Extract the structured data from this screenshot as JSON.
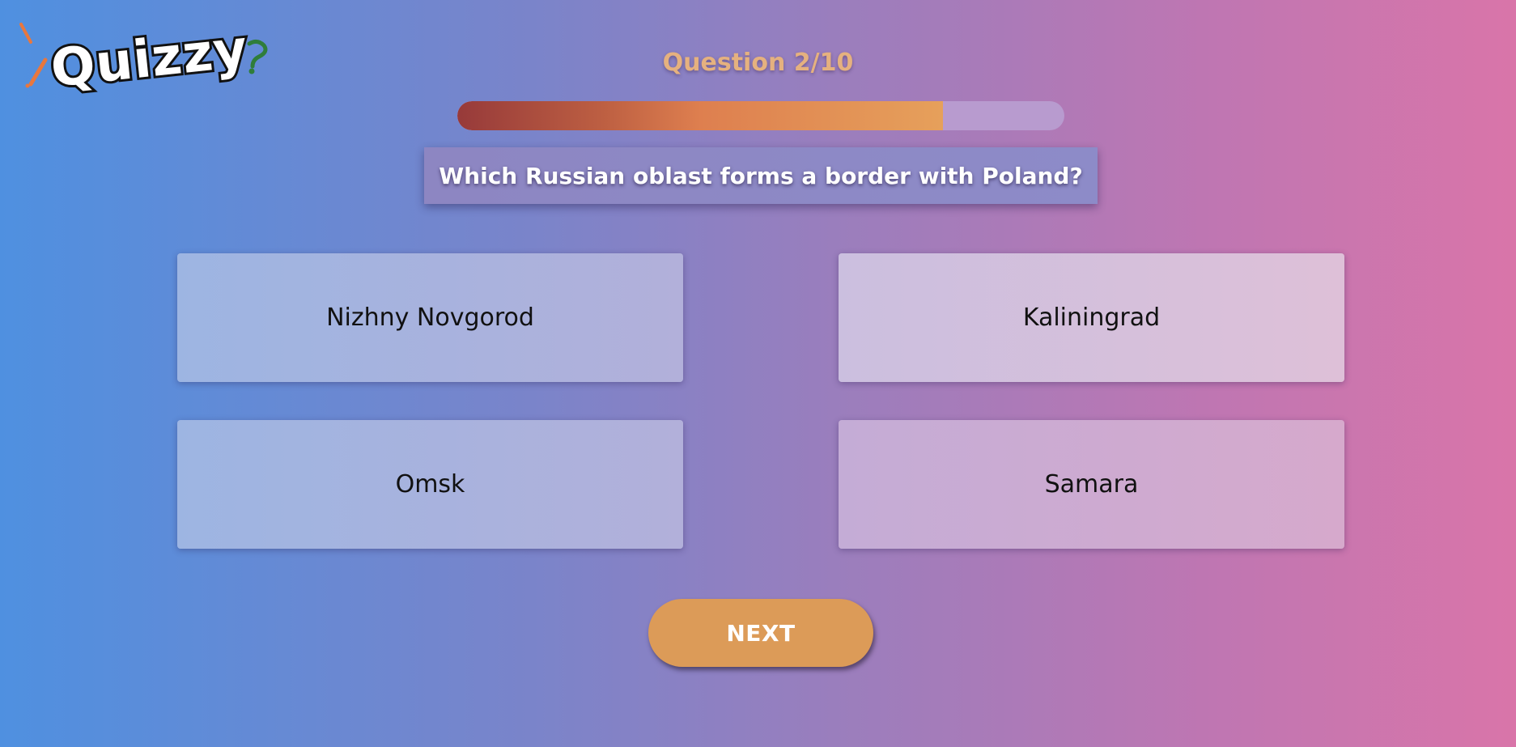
{
  "app": {
    "logo_text": "Quizzy"
  },
  "quiz": {
    "counter": "Question 2/10",
    "progress_fraction": 0.8,
    "question": "Which Russian oblast forms a border with Poland?",
    "answers": [
      {
        "label": "Nizhny Novgorod"
      },
      {
        "label": "Kaliningrad"
      },
      {
        "label": "Omsk"
      },
      {
        "label": "Samara"
      }
    ],
    "next_label": "NEXT"
  },
  "colors": {
    "counter": "#e5b17f",
    "next_button": "#dc9b58",
    "progress_track": "#b89bcf"
  }
}
